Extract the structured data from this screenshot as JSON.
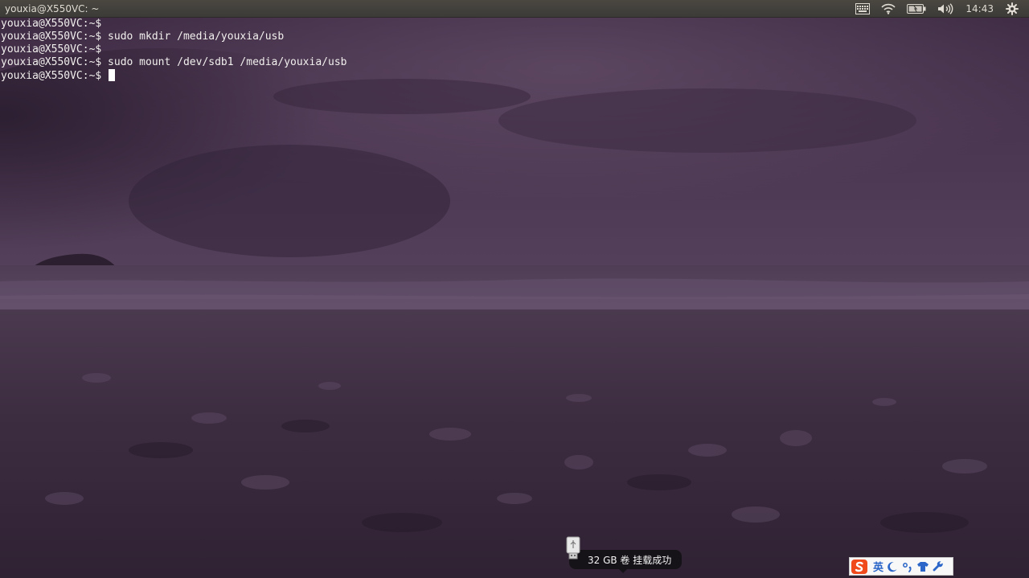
{
  "top_panel": {
    "window_title": "youxia@X550VC: ~",
    "clock": "14:43",
    "indicators": [
      "keyboard-icon",
      "wifi-icon",
      "battery-icon",
      "volume-icon",
      "gear-icon"
    ]
  },
  "terminal": {
    "lines": [
      "youxia@X550VC:~$",
      "youxia@X550VC:~$ sudo mkdir /media/youxia/usb",
      "youxia@X550VC:~$",
      "youxia@X550VC:~$ sudo mount /dev/sdb1 /media/youxia/usb",
      "youxia@X550VC:~$ "
    ]
  },
  "notification": {
    "text": "32 GB 卷 挂载成功",
    "icon": "usb-drive-icon"
  },
  "ime_bar": {
    "language": "英",
    "icons": [
      "sogou-logo-icon",
      "moon-icon",
      "punctuation-icon",
      "shirt-skin-icon",
      "wrench-icon"
    ],
    "accent_color": "#2b66c8"
  }
}
